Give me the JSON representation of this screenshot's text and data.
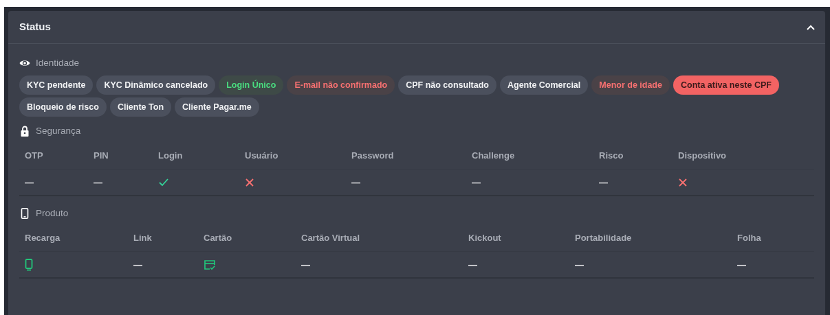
{
  "panel": {
    "title": "Status",
    "expanded": true
  },
  "identity": {
    "label": "Identidade",
    "chips": [
      {
        "text": "KYC pendente",
        "kind": "neutral"
      },
      {
        "text": "KYC Dinâmico cancelado",
        "kind": "neutral"
      },
      {
        "text": "Login Único",
        "kind": "success"
      },
      {
        "text": "E-mail não confirmado",
        "kind": "danger"
      },
      {
        "text": "CPF não consultado",
        "kind": "neutral"
      },
      {
        "text": "Agente Comercial",
        "kind": "neutral"
      },
      {
        "text": "Menor de idade",
        "kind": "danger"
      },
      {
        "text": "Conta ativa neste CPF",
        "kind": "alert"
      },
      {
        "text": "Bloqueio de risco",
        "kind": "neutral"
      },
      {
        "text": "Cliente Ton",
        "kind": "neutral"
      },
      {
        "text": "Cliente Pagar.me",
        "kind": "neutral"
      }
    ]
  },
  "security": {
    "label": "Segurança",
    "columns": [
      {
        "header": "OTP",
        "value": {
          "kind": "dash",
          "text": "—"
        }
      },
      {
        "header": "PIN",
        "value": {
          "kind": "dash",
          "text": "—"
        }
      },
      {
        "header": "Login",
        "value": {
          "kind": "check"
        }
      },
      {
        "header": "Usuário",
        "value": {
          "kind": "cross"
        }
      },
      {
        "header": "Password",
        "value": {
          "kind": "dash",
          "text": "—"
        }
      },
      {
        "header": "Challenge",
        "value": {
          "kind": "dash",
          "text": "—"
        }
      },
      {
        "header": "Risco",
        "value": {
          "kind": "dash",
          "text": "—"
        }
      },
      {
        "header": "Dispositivo",
        "value": {
          "kind": "cross"
        }
      }
    ]
  },
  "product": {
    "label": "Produto",
    "columns": [
      {
        "header": "Recarga",
        "value": {
          "kind": "phone"
        }
      },
      {
        "header": "Link",
        "value": {
          "kind": "dash",
          "text": "—"
        }
      },
      {
        "header": "Cartão",
        "value": {
          "kind": "card"
        }
      },
      {
        "header": "Cartão Virtual",
        "value": {
          "kind": "dash",
          "text": "—"
        }
      },
      {
        "header": "Kickout",
        "value": {
          "kind": "dash",
          "text": "—"
        }
      },
      {
        "header": "Portabilidade",
        "value": {
          "kind": "dash",
          "text": "—"
        }
      },
      {
        "header": "Folha",
        "value": {
          "kind": "dash",
          "text": "—"
        }
      }
    ]
  }
}
